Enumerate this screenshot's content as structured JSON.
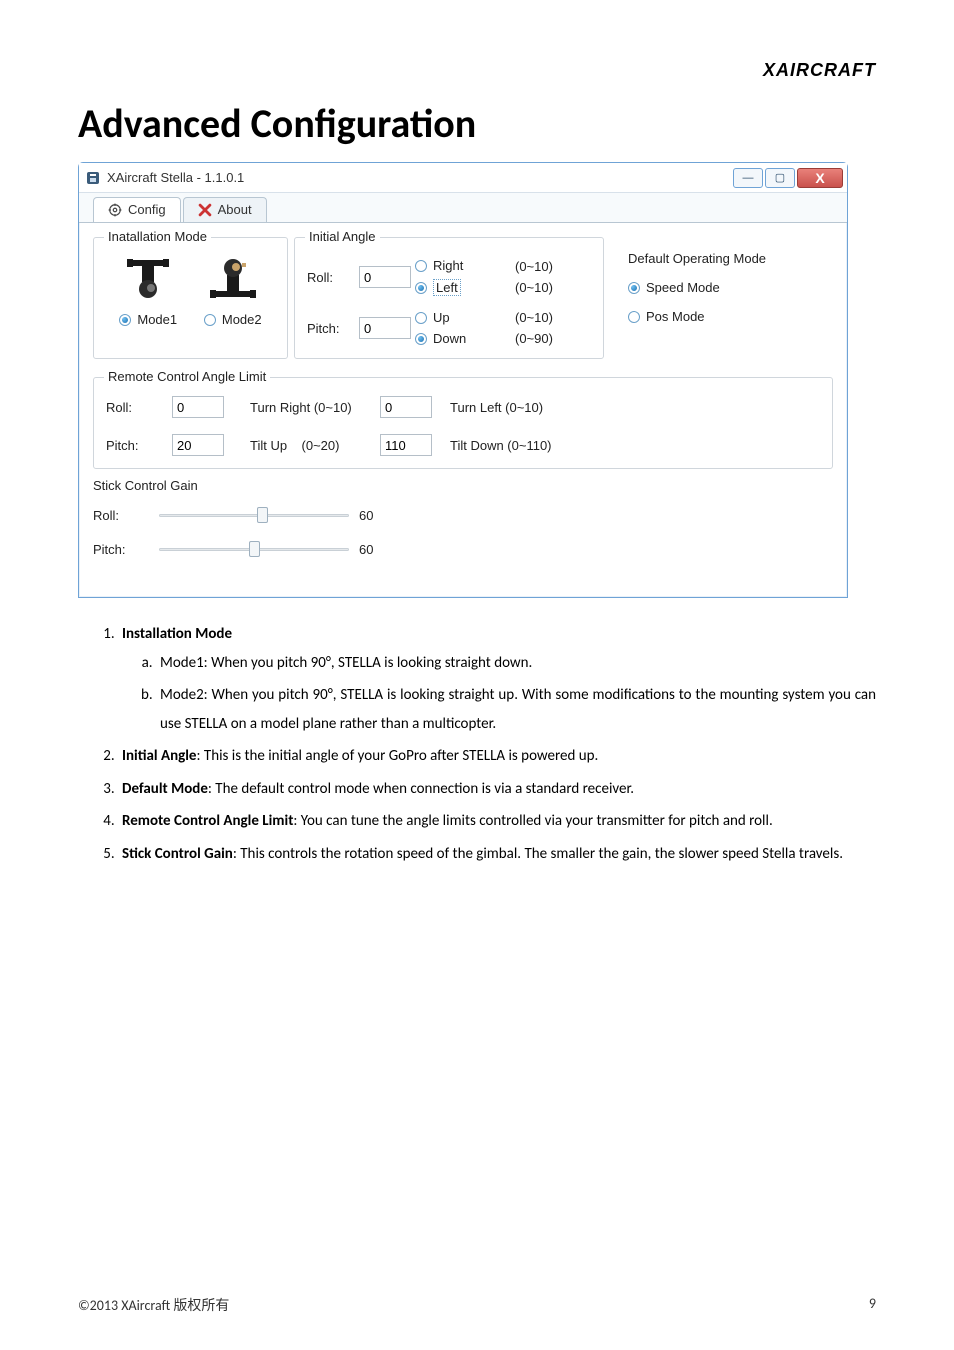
{
  "brand": "XAIRCRAFT",
  "page_title": "Advanced Configuration",
  "window": {
    "title": "XAircraft Stella - 1.1.0.1",
    "tabs": {
      "config": "Config",
      "about": "About"
    }
  },
  "install": {
    "legend": "Inatallation Mode",
    "mode1": "Mode1",
    "mode2": "Mode2",
    "selected": "mode1"
  },
  "init": {
    "legend": "Initial Angle",
    "roll_label": "Roll:",
    "roll_value": "0",
    "roll_right": "Right",
    "roll_right_range": "(0~10)",
    "roll_left": "Left",
    "roll_left_range": "(0~10)",
    "roll_sel": "left",
    "pitch_label": "Pitch:",
    "pitch_value": "0",
    "pitch_up": "Up",
    "pitch_up_range": "(0~10)",
    "pitch_down": "Down",
    "pitch_down_range": "(0~90)",
    "pitch_sel": "down"
  },
  "defmode": {
    "legend": "Default Operating Mode",
    "speed": "Speed Mode",
    "pos": "Pos Mode",
    "selected": "speed"
  },
  "limit": {
    "legend": "Remote Control Angle Limit",
    "roll_label": "Roll:",
    "roll_right_value": "0",
    "roll_right_label": "Turn Right (0~10)",
    "roll_left_value": "0",
    "roll_left_label": "Turn Left (0~10)",
    "pitch_label": "Pitch:",
    "pitch_up_value": "20",
    "pitch_up_label": "Tilt Up    (0~20)",
    "pitch_down_value": "110",
    "pitch_down_label": "Tilt Down (0~110)"
  },
  "gain": {
    "legend": "Stick Control Gain",
    "roll_label": "Roll:",
    "roll_value": "60",
    "roll_pct": 55,
    "pitch_label": "Pitch:",
    "pitch_value": "60",
    "pitch_pct": 50
  },
  "doc": {
    "item1_title": "Installation Mode",
    "item1a": "Mode1: When you pitch 90°, STELLA is looking straight down.",
    "item1b": "Mode2: When you pitch 90°, STELLA is looking straight up. With some modifications to the mounting system you can use STELLA on a model plane rather than a multicopter.",
    "item2_title": "Initial Angle",
    "item2_rest": ": This is the initial angle of your GoPro after STELLA is powered up.",
    "item3_title": "Default Mode",
    "item3_rest": ": The default control mode when connection is via a standard receiver.",
    "item4_title": "Remote Control Angle Limit",
    "item4_rest": ": You can tune the angle limits controlled via your transmitter for pitch and roll.",
    "item5_title": "Stick Control Gain",
    "item5_rest": ": This controls the rotation speed of the gimbal. The smaller the gain, the slower speed Stella travels."
  },
  "footer_left": "©2013 XAircraft  版权所有",
  "footer_right": "9"
}
